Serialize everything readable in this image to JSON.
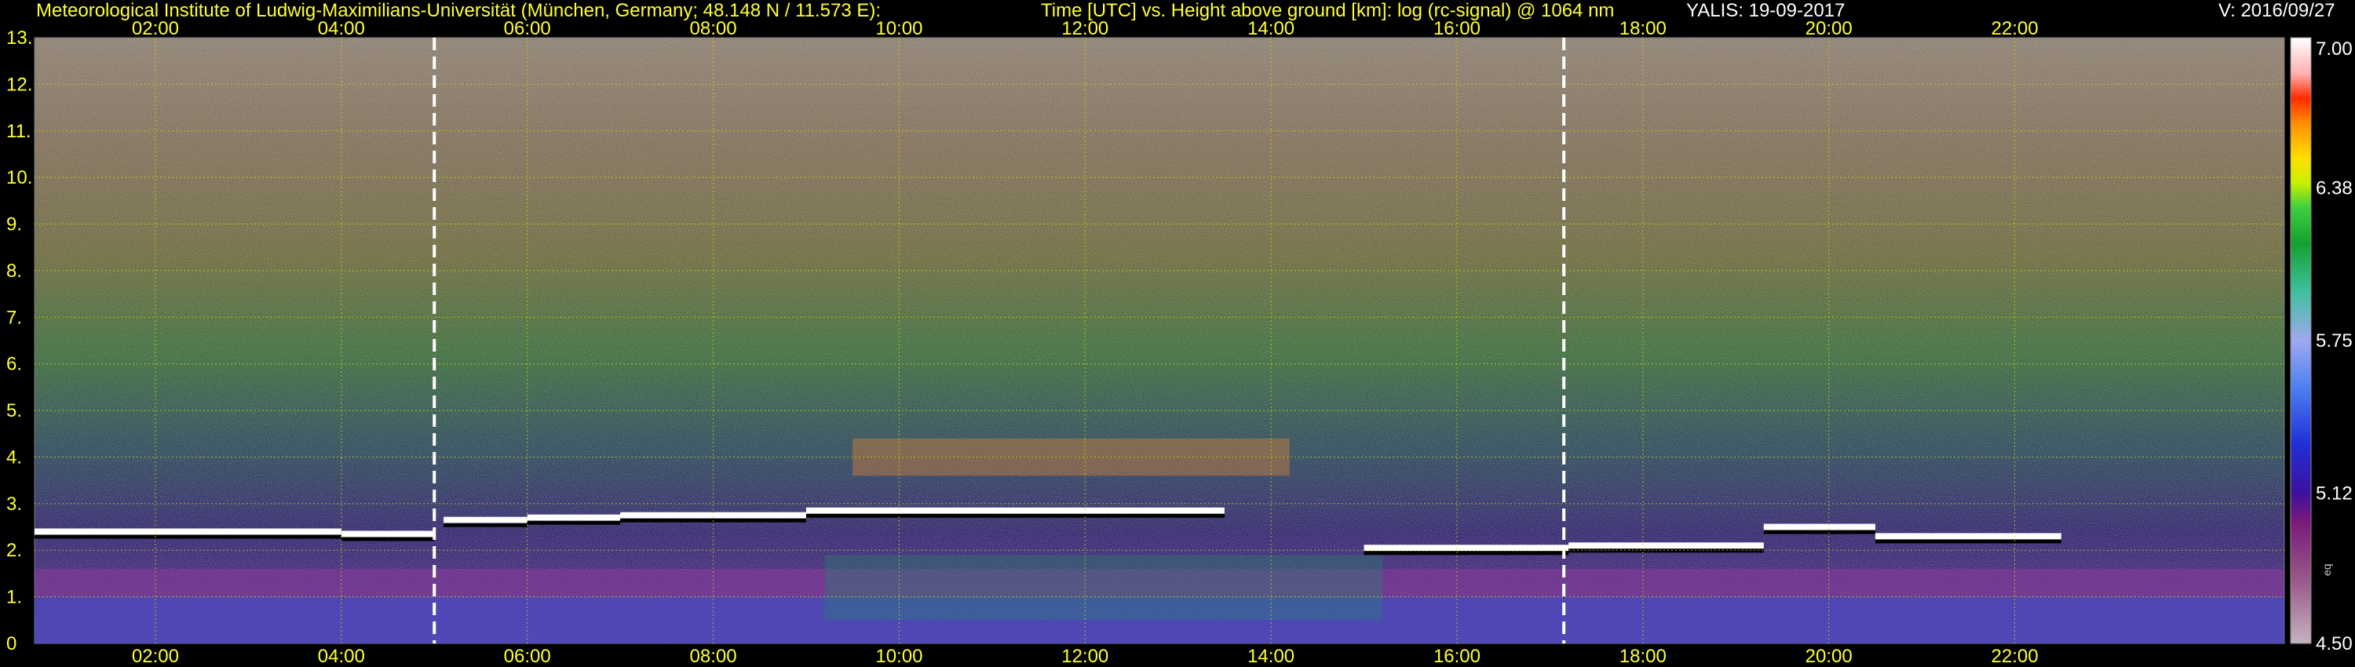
{
  "header": {
    "institute": "Meteorological Institute of Ludwig-Maximilians-Universität (München, Germany; 48.148 N / 11.573 E):",
    "title": "Time [UTC] vs. Height above ground [km]: log (rc-signal) @ 1064 nm",
    "instrument_date": "YALIS: 19-09-2017",
    "version": "V: 2016/09/27"
  },
  "colors": {
    "text_yellow": "#ffff33",
    "text_white": "#ffffff",
    "background": "#000000",
    "grid": "#d8d800"
  },
  "chart_data": {
    "type": "heatmap",
    "title": "Time [UTC] vs. Height above ground [km]: log (rc-signal) @ 1064 nm",
    "x_unit": "hours UTC",
    "xlim": [
      0.7,
      24.9
    ],
    "x_ticks": [
      2,
      4,
      6,
      8,
      10,
      12,
      14,
      16,
      18,
      20,
      22
    ],
    "x_tick_labels": [
      "02:00",
      "04:00",
      "06:00",
      "08:00",
      "10:00",
      "12:00",
      "14:00",
      "16:00",
      "18:00",
      "20:00",
      "22:00"
    ],
    "y_unit": "km",
    "ylim": [
      0,
      13
    ],
    "y_ticks": [
      0,
      1,
      2,
      3,
      4,
      5,
      6,
      7,
      8,
      9,
      10,
      11,
      12,
      13
    ],
    "y_tick_labels": [
      "0",
      "1.",
      "2.",
      "3.",
      "4.",
      "5.",
      "6.",
      "7.",
      "8.",
      "9.",
      "10.",
      "11.",
      "12.",
      "13."
    ],
    "grid": true,
    "colorbar": {
      "range": [
        4.5,
        7.0
      ],
      "tick_values": [
        4.5,
        5.12,
        5.75,
        6.38,
        7.0
      ],
      "tick_labels": [
        "4.50",
        "5.12",
        "5.75",
        "6.38",
        "7.00"
      ],
      "annotation": "eq"
    },
    "dashed_vertical_lines_utc": [
      5.0,
      17.15
    ],
    "cloud_layers": [
      {
        "t0": 0.7,
        "t1": 4.0,
        "h": 2.4
      },
      {
        "t0": 4.0,
        "t1": 5.0,
        "h": 2.35
      },
      {
        "t0": 5.1,
        "t1": 6.0,
        "h": 2.65
      },
      {
        "t0": 6.0,
        "t1": 7.0,
        "h": 2.7
      },
      {
        "t0": 7.0,
        "t1": 9.0,
        "h": 2.75
      },
      {
        "t0": 9.0,
        "t1": 13.5,
        "h": 2.85
      },
      {
        "t0": 15.0,
        "t1": 17.2,
        "h": 2.05
      },
      {
        "t0": 17.2,
        "t1": 19.3,
        "h": 2.1
      },
      {
        "t0": 19.3,
        "t1": 20.5,
        "h": 2.5
      },
      {
        "t0": 20.5,
        "t1": 22.5,
        "h": 2.3
      }
    ],
    "high_signal_patches": [
      {
        "t0": 9.5,
        "t1": 14.2,
        "h0": 3.6,
        "h1": 4.4
      }
    ]
  }
}
